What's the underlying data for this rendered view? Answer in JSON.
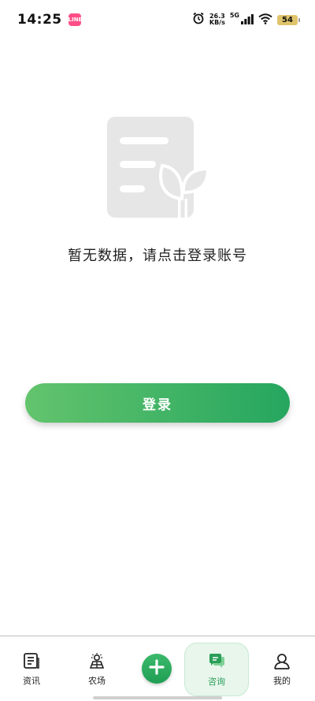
{
  "status_bar": {
    "time": "14:25",
    "app_badge": "LINE",
    "net_speed_value": "26.3",
    "net_speed_unit": "KB/s",
    "network_gen": "5G",
    "battery": "54"
  },
  "empty_state": {
    "message": "暂无数据，请点击登录账号"
  },
  "login_button_label": "登录",
  "bottom_nav": {
    "items": [
      {
        "label": "资讯"
      },
      {
        "label": "农场"
      },
      {
        "label": "咨询"
      },
      {
        "label": "我的"
      }
    ],
    "active": "咨询"
  },
  "colors": {
    "accent": "#25a65f",
    "accent_light": "#63c46d",
    "active_tab_bg": "#e8f6ec",
    "illustration": "#e6e6e6"
  },
  "icons": {
    "status": [
      "alarm-icon",
      "signal-icon",
      "wifi-icon",
      "battery-icon"
    ],
    "nav": [
      "news-icon",
      "farm-icon",
      "add-icon",
      "consult-icon",
      "profile-icon"
    ]
  }
}
